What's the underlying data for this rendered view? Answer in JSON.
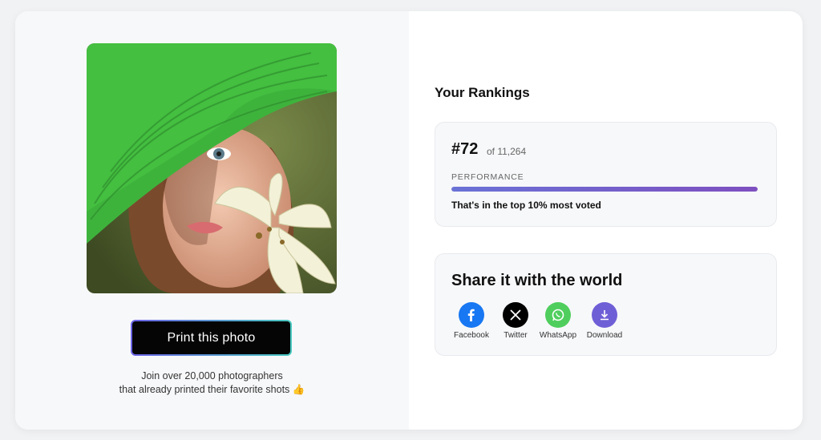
{
  "photo": {
    "alt": "Girl in green hat with white lily"
  },
  "print_button": {
    "label": "Print this photo"
  },
  "join": {
    "line1": "Join over 20,000 photographers",
    "line2": "that already printed their favorite shots 👍"
  },
  "rankings": {
    "title": "Your Rankings",
    "rank": "#72",
    "of_total": "of 11,264",
    "performance_label": "PERFORMANCE",
    "performance_fraction": 1.0,
    "summary": "That's in the top 10% most voted"
  },
  "share": {
    "title": "Share it with the world",
    "items": [
      {
        "label": "Facebook",
        "icon": "facebook-icon",
        "color": "#1877f2"
      },
      {
        "label": "Twitter",
        "icon": "x-icon",
        "color": "#000000"
      },
      {
        "label": "WhatsApp",
        "icon": "whatsapp-icon",
        "color": "#4fce5d"
      },
      {
        "label": "Download",
        "icon": "download-icon",
        "color": "#6f5fd6"
      }
    ]
  },
  "colors": {
    "accent_gradient_start": "#6a72d6",
    "accent_gradient_end": "#7e4fc0",
    "button_bg": "#050505"
  }
}
